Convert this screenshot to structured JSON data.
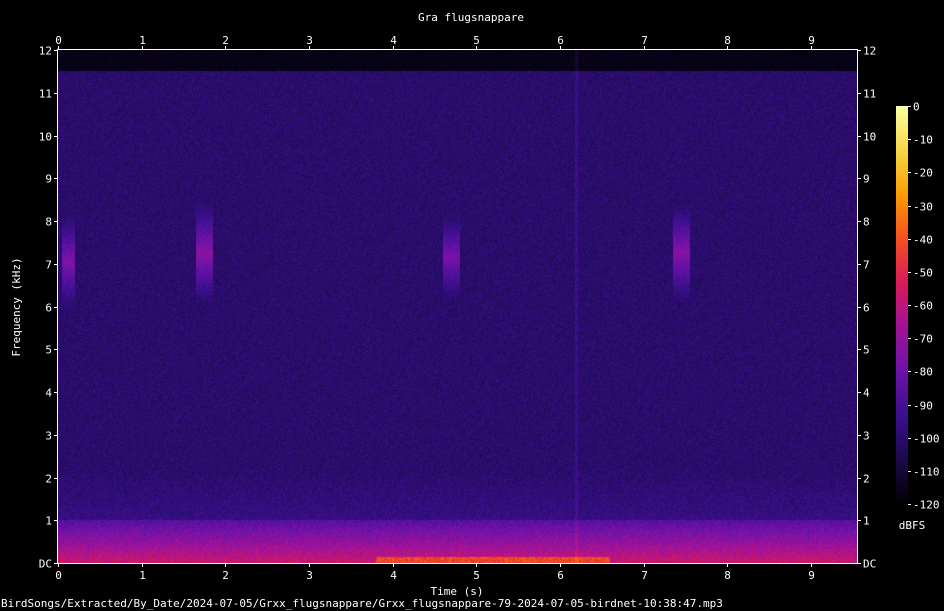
{
  "chart_data": {
    "type": "heatmap",
    "title": "Gra flugsnappare",
    "xlabel": "Time (s)",
    "ylabel": "Frequency (kHz)",
    "xlim": [
      0,
      9.55
    ],
    "ylim": [
      0,
      12
    ],
    "x_ticks": [
      "0",
      "1",
      "2",
      "3",
      "4",
      "5",
      "6",
      "7",
      "8",
      "9"
    ],
    "y_ticks": [
      "DC",
      "1",
      "2",
      "3",
      "4",
      "5",
      "6",
      "7",
      "8",
      "9",
      "10",
      "11",
      "12"
    ],
    "colorbar": {
      "label": "dBFS",
      "range": [
        -120,
        0
      ],
      "ticks": [
        "0",
        "-10",
        "-20",
        "-30",
        "-40",
        "-50",
        "-60",
        "-70",
        "-80",
        "-90",
        "-100",
        "-110",
        "-120"
      ],
      "colormap": [
        "#000000",
        "#1a0a4a",
        "#3a0f8c",
        "#6a12a8",
        "#a0129a",
        "#d81a5a",
        "#f4501e",
        "#fb9b06",
        "#f6d746",
        "#fcffa4"
      ]
    },
    "calls": [
      {
        "t_start": 0.05,
        "t_end": 0.2,
        "f_low": 5.8,
        "f_high": 8.3,
        "level_db": -75
      },
      {
        "t_start": 1.65,
        "t_end": 1.85,
        "f_low": 6.1,
        "f_high": 8.4,
        "level_db": -72
      },
      {
        "t_start": 4.6,
        "t_end": 4.8,
        "f_low": 6.0,
        "f_high": 8.3,
        "level_db": -76
      },
      {
        "t_start": 7.35,
        "t_end": 7.55,
        "f_low": 6.1,
        "f_high": 8.4,
        "level_db": -73
      }
    ],
    "noise_band": {
      "f_low": 0,
      "f_high": 1.0,
      "level_db": -65
    },
    "noise_peak": {
      "t_start": 3.8,
      "t_end": 6.6,
      "f_low": 0,
      "f_high": 0.15,
      "level_db": -40
    },
    "background_level_db": -100
  },
  "footer": {
    "path": "BirdSongs/Extracted/By_Date/2024-07-05/Grxx_flugsnappare/Grxx_flugsnappare-79-2024-07-05-birdnet-10:38:47.mp3"
  }
}
